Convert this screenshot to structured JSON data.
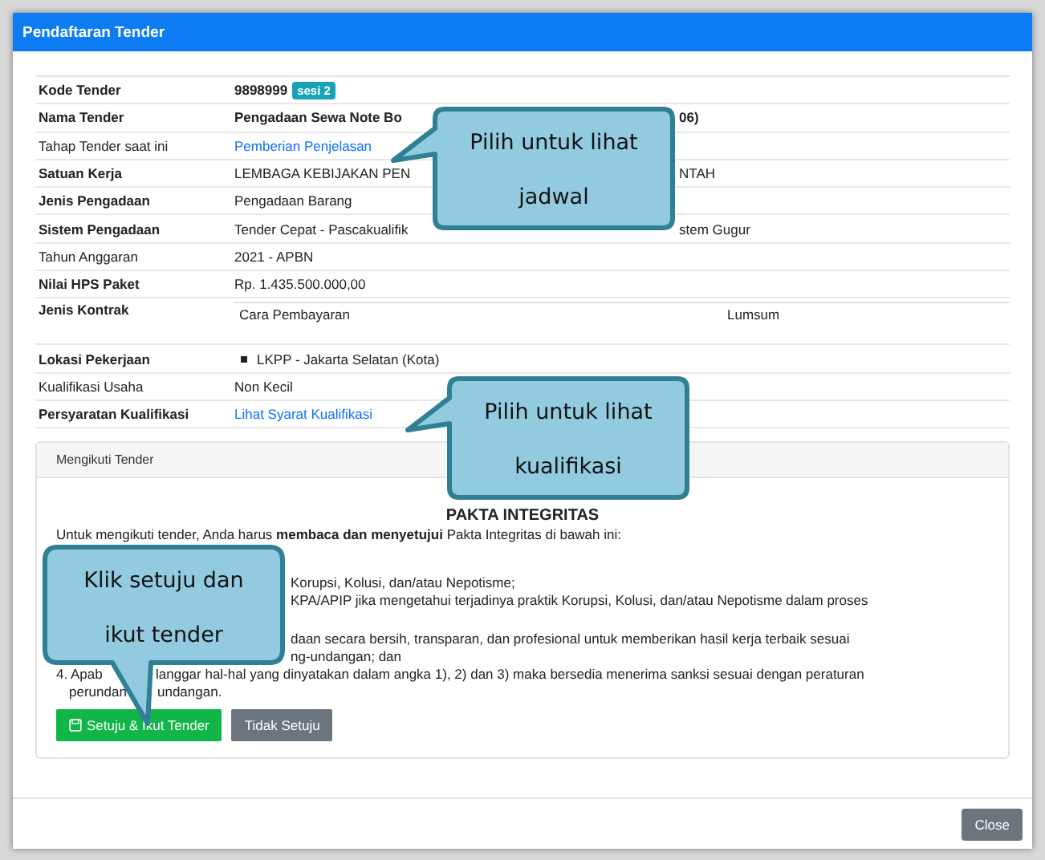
{
  "window": {
    "title": "Pendaftaran Tender"
  },
  "details": [
    {
      "kind": "code",
      "label": "Kode Tender",
      "bold": true,
      "value": "9898999",
      "badge": "sesi 2"
    },
    {
      "kind": "split",
      "label": "Nama Tender",
      "bold": true,
      "value": "Pengadaan Sewa Note Bo",
      "value_after": "06)",
      "value_bold": true
    },
    {
      "kind": "link",
      "label": "Tahap Tender saat ini",
      "bold": false,
      "value": "Pemberian Penjelasan"
    },
    {
      "kind": "split",
      "label": "Satuan Kerja",
      "bold": true,
      "value": "LEMBAGA KEBIJAKAN PEN",
      "value_after": "NTAH",
      "value_bold": false
    },
    {
      "kind": "text",
      "label": "Jenis Pengadaan",
      "bold": true,
      "value": "Pengadaan Barang"
    },
    {
      "kind": "split",
      "label": "Sistem Pengadaan",
      "bold": true,
      "value": "Tender Cepat - Pascakualifik",
      "value_after": "stem Gugur",
      "value_bold": false
    },
    {
      "kind": "text",
      "label": "Tahun Anggaran",
      "bold": false,
      "value": "2021 - APBN"
    },
    {
      "kind": "text",
      "label": "Nilai HPS Paket",
      "bold": true,
      "value": "Rp. 1.435.500.000,00"
    },
    {
      "kind": "contract",
      "label": "Jenis Kontrak",
      "bold": true,
      "value": "Cara Pembayaran",
      "value_after": "Lumsum"
    },
    {
      "kind": "location",
      "label": "Lokasi Pekerjaan",
      "bold": true,
      "value": "LKPP - Jakarta Selatan (Kota)"
    },
    {
      "kind": "text",
      "label": "Kualifikasi Usaha",
      "bold": false,
      "value": "Non Kecil"
    },
    {
      "kind": "link",
      "label": "Persyaratan Kualifikasi",
      "bold": true,
      "value": "Lihat Syarat Kualifikasi"
    }
  ],
  "panel": {
    "title": "Mengikuti Tender",
    "heading": "PAKTA INTEGRITAS",
    "lines": [
      {
        "kind": "full",
        "segments": [
          "Untuk mengikuti tender, Anda harus **membaca dan menyetujui** Pakta Integritas di bawah ini:"
        ]
      },
      {
        "kind": "right",
        "segments": [
          "Korupsi, Kolusi, dan/atau Nepotisme;"
        ]
      },
      {
        "kind": "right",
        "segments": [
          "KPA/APIP jika mengetahui terjadinya praktik Korupsi, Kolusi, dan/atau Nepotisme dalam proses"
        ]
      },
      {
        "kind": "right",
        "segments": [
          "daan secara bersih, transparan, dan profesional untuk memberikan hasil kerja terbaik sesuai"
        ]
      },
      {
        "kind": "right",
        "segments": [
          "ng-undangan; dan"
        ]
      },
      {
        "kind": "split-item",
        "segments": [
          "4. Apab",
          "langgar hal-hal yang dinyatakan dalam angka 1), 2) dan 3) maka bersedia menerima sanksi sesuai dengan peraturan"
        ]
      },
      {
        "kind": "split-cont",
        "segments": [
          "perundan",
          "undangan."
        ]
      }
    ],
    "buttons": [
      {
        "kind": "agree",
        "label": "Setuju & Ikut Tender"
      },
      {
        "kind": "disagree",
        "label": "Tidak Setuju"
      }
    ]
  },
  "footer": {
    "button": "Close"
  },
  "callouts": [
    {
      "kind": "left",
      "lines": [
        "Pilih untuk lihat",
        "jadwal"
      ]
    },
    {
      "kind": "left",
      "lines": [
        "Pilih untuk lihat",
        "kualifikasi"
      ]
    },
    {
      "kind": "down",
      "lines": [
        "Klik setuju dan",
        "ikut tender"
      ]
    }
  ]
}
